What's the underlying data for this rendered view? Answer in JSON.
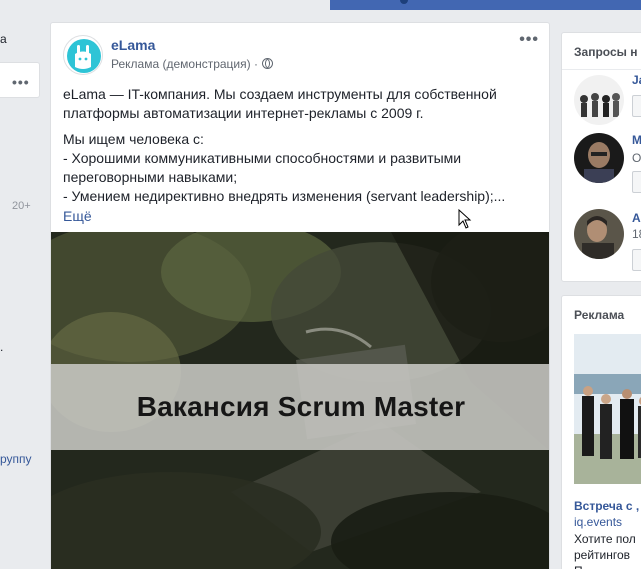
{
  "left": {
    "text_top": "а",
    "count": "20+",
    "text_mid": ".",
    "group_link": "руппу"
  },
  "post": {
    "page_name": "eLama",
    "sponsored": "Реклама (демонстрация) ·",
    "paragraph1": "eLama — IT-компания. Мы создаем инструменты для собственной платформы автоматизации интернет-рекламы с 2009 г.",
    "paragraph2_lines": [
      "Мы ищем человека с:",
      "- Хорошими коммуникативными способностями и развитыми переговорными навыками;",
      "- Умением недирективно внедрять изменения (servant leadership);..."
    ],
    "more": "Ещё",
    "banner": "Вакансия Scrum Master"
  },
  "right": {
    "requests_title": "Запросы н",
    "requests": [
      {
        "name": "Ja",
        "sub": ""
      },
      {
        "name": "M",
        "sub": "O"
      },
      {
        "name": "A",
        "sub": "18"
      }
    ],
    "ads_title": "Реклама",
    "ad_title": "Встреча с ,",
    "ad_domain": "iq.events",
    "ad_desc_lines": [
      "Хотите пол",
      "рейтингов",
      "П"
    ]
  },
  "colors": {
    "link": "#365899",
    "background": "#e9ebee",
    "topbar": "#4267b2"
  }
}
